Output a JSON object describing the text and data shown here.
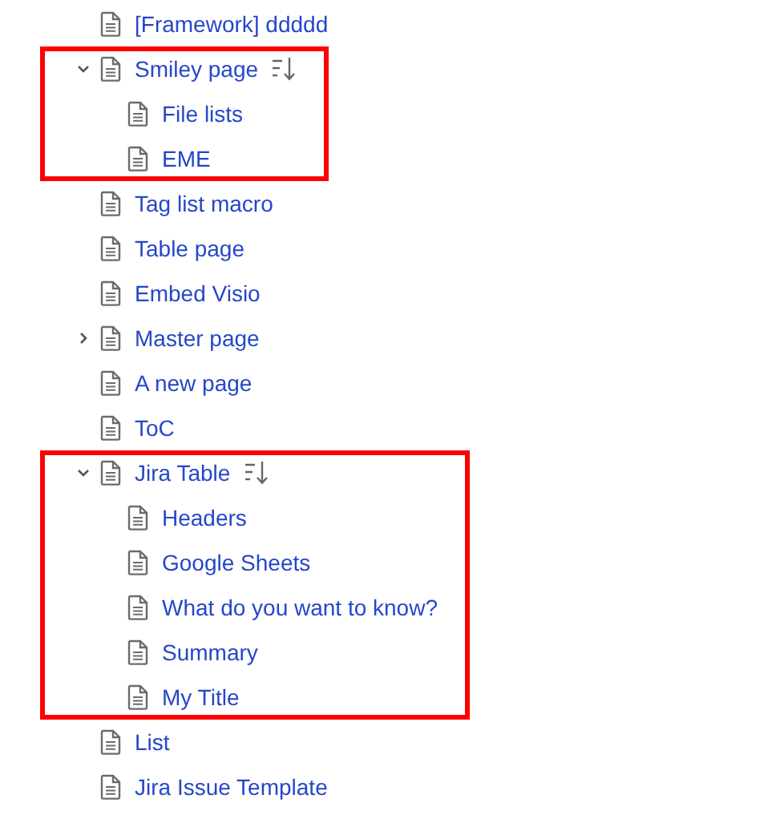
{
  "tree": [
    {
      "title": "[Framework] ddddd",
      "expandable": false,
      "sorted": false,
      "highlighted": false
    },
    {
      "title": "Smiley page",
      "expandable": true,
      "expanded": true,
      "sorted": true,
      "highlighted": true,
      "children": [
        {
          "title": "File lists",
          "expandable": false,
          "sorted": false,
          "highlighted": false
        },
        {
          "title": "EME",
          "expandable": false,
          "sorted": false,
          "highlighted": false
        }
      ]
    },
    {
      "title": "Tag list macro",
      "expandable": false,
      "sorted": false,
      "highlighted": false
    },
    {
      "title": "Table page",
      "expandable": false,
      "sorted": false,
      "highlighted": false
    },
    {
      "title": "Embed Visio",
      "expandable": false,
      "sorted": false,
      "highlighted": false
    },
    {
      "title": "Master page",
      "expandable": true,
      "expanded": false,
      "sorted": false,
      "highlighted": false
    },
    {
      "title": "A new page",
      "expandable": false,
      "sorted": false,
      "highlighted": false
    },
    {
      "title": "ToC",
      "expandable": false,
      "sorted": false,
      "highlighted": false
    },
    {
      "title": "Jira Table",
      "expandable": true,
      "expanded": true,
      "sorted": true,
      "highlighted": true,
      "children": [
        {
          "title": "Headers",
          "expandable": false,
          "sorted": false,
          "highlighted": false
        },
        {
          "title": "Google Sheets",
          "expandable": false,
          "sorted": false,
          "highlighted": false
        },
        {
          "title": "What do you want to know?",
          "expandable": false,
          "sorted": false,
          "highlighted": false
        },
        {
          "title": "Summary",
          "expandable": false,
          "sorted": false,
          "highlighted": false
        },
        {
          "title": "My Title",
          "expandable": false,
          "sorted": false,
          "highlighted": false
        }
      ]
    },
    {
      "title": "List",
      "expandable": false,
      "sorted": false,
      "highlighted": false
    },
    {
      "title": "Jira Issue Template",
      "expandable": false,
      "sorted": false,
      "highlighted": false
    }
  ]
}
